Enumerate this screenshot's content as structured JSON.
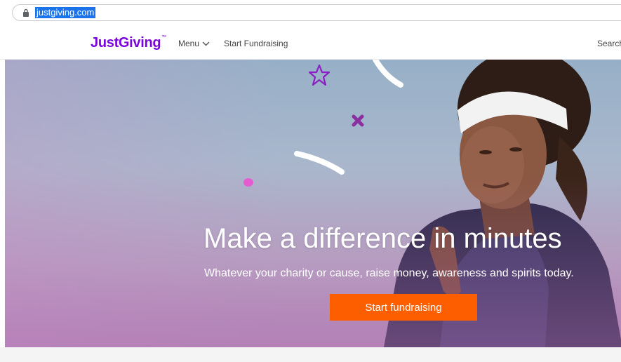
{
  "browser": {
    "url": "justgiving.com",
    "icons": {
      "lock": "lock-icon"
    }
  },
  "header": {
    "logo_text": "JustGiving",
    "logo_mark": "™",
    "menu_label": "Menu",
    "start_fundraising_label": "Start Fundraising",
    "search_label": "Search",
    "icons": {
      "menu_chevron": "chevron-down-icon"
    },
    "colors": {
      "brand": "#7a04dd"
    }
  },
  "hero": {
    "title": "Make a difference in minutes",
    "subtitle": "Whatever your charity or cause, raise money, awareness and spirits today.",
    "cta_label": "Start fundraising",
    "colors": {
      "cta": "#fd5f00"
    }
  }
}
